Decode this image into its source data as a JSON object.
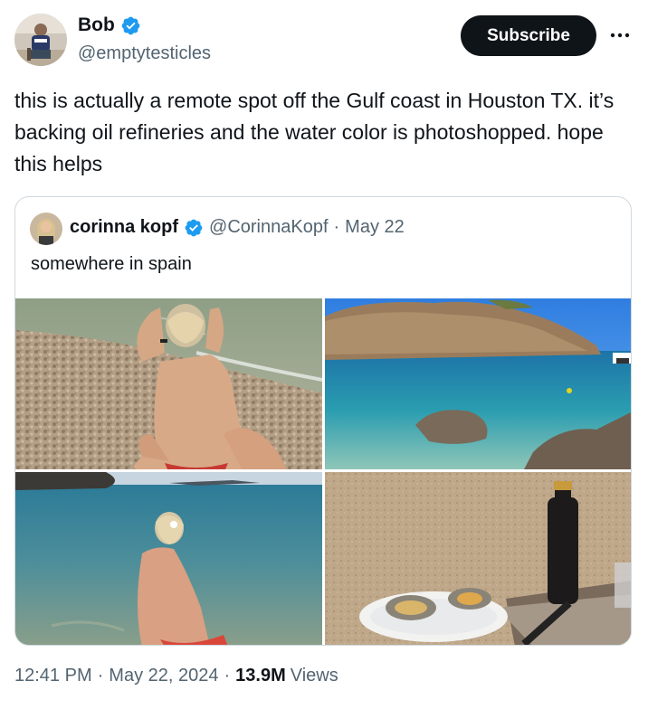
{
  "author": {
    "name": "Bob",
    "handle": "@emptytesticles",
    "verified_icon": "verified-badge-icon",
    "avatar_icon": "profile-photo"
  },
  "actions": {
    "subscribe_label": "Subscribe",
    "more_icon": "more-dots-icon"
  },
  "tweet": {
    "text": "this is actually a remote spot off the Gulf coast in Houston TX. it’s backing oil refineries and the water color is photoshopped. hope this helps"
  },
  "quoted_tweet": {
    "name": "corinna kopf",
    "handle": "@CorinnaKopf",
    "separator": "·",
    "date": "May 22",
    "text": "somewhere in spain",
    "photos": [
      "beach-photo-1",
      "cove-photo-2",
      "sea-photo-3",
      "oysters-photo-4"
    ]
  },
  "meta": {
    "time": "12:41 PM",
    "separator": "·",
    "date": "May 22, 2024",
    "views_count": "13.9M",
    "views_label": "Views"
  },
  "colors": {
    "text": "#0f1419",
    "secondary": "#536471",
    "verified_blue": "#1d9bf0",
    "border": "#cfd9de",
    "subscribe_bg": "#0f1419"
  }
}
